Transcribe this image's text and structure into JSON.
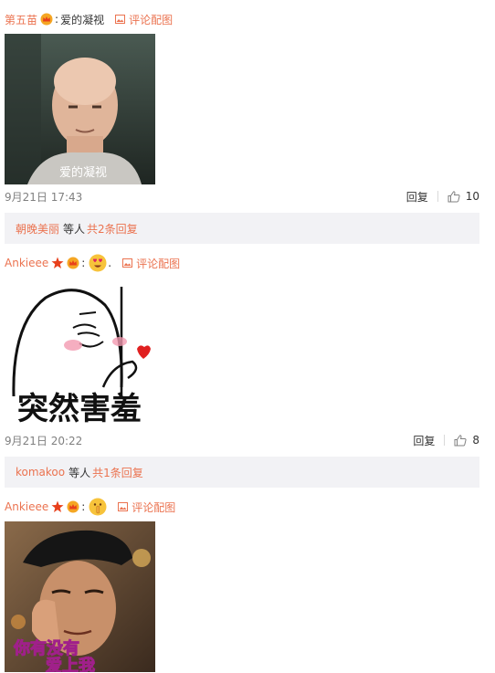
{
  "comments": [
    {
      "user": "第五苗",
      "text": "爱的凝视",
      "pic_link": "评论配图",
      "image_caption": "爱的凝视",
      "time": "9月21日 17:43",
      "reply_label": "回复",
      "likes": "10",
      "reply_summary": {
        "user": "朝晚美丽",
        "middle": "等人",
        "count_text": "共2条回复"
      }
    },
    {
      "user": "Ankieee",
      "text": ".",
      "emoji": "heart-eyes-emoji",
      "pic_link": "评论配图",
      "image_caption": "突然害羞",
      "time": "9月21日 20:22",
      "reply_label": "回复",
      "likes": "8",
      "reply_summary": {
        "user": "komakoo",
        "middle": "等人",
        "count_text": "共1条回复"
      }
    },
    {
      "user": "Ankieee",
      "emoji": "shush-emoji",
      "pic_link": "评论配图",
      "image_caption_line1": "你有没有",
      "image_caption_line2": "爱上我"
    }
  ],
  "colors": {
    "link": "#eb7350",
    "text": "#333333",
    "muted": "#808080",
    "reply_bg": "#f2f2f5"
  }
}
